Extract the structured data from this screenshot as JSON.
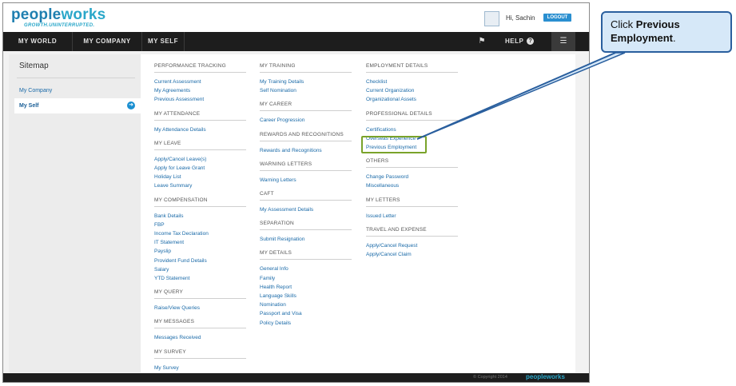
{
  "app": {
    "logo_text_a": "pe",
    "logo_text_b": "ple",
    "logo_text_c": "works",
    "tagline": "GROWTH.UNINTERRUPTED.",
    "greeting": "Hi, Sachin",
    "logout_label": "LOGOUT"
  },
  "nav": {
    "items": [
      {
        "label": "MY WORLD"
      },
      {
        "label": "MY COMPANY"
      },
      {
        "label": "MY SELF"
      }
    ],
    "help_label": "HELP"
  },
  "sidebar": {
    "title": "Sitemap",
    "items": [
      {
        "label": "My Company"
      },
      {
        "label": "My Self"
      }
    ]
  },
  "columns": {
    "col1": {
      "sections": [
        {
          "title": "PERFORMANCE TRACKING",
          "links": [
            "Current Assessment",
            "My Agreements",
            "Previous Assessment"
          ]
        },
        {
          "title": "MY ATTENDANCE",
          "links": [
            "My Attendance Details"
          ]
        },
        {
          "title": "MY LEAVE",
          "links": [
            "Apply/Cancel Leave(s)",
            "Apply for Leave Grant",
            "Holiday List",
            "Leave Summary"
          ]
        },
        {
          "title": "MY COMPENSATION",
          "links": [
            "Bank Details",
            "FBP",
            "Income Tax Declaration",
            "IT Statement",
            "Payslip",
            "Provident Fund Details",
            "Salary",
            "YTD Statement"
          ]
        },
        {
          "title": "MY QUERY",
          "links": [
            "Raise/View Queries"
          ]
        },
        {
          "title": "MY MESSAGES",
          "links": [
            "Messages Received"
          ]
        },
        {
          "title": "MY SURVEY",
          "links": [
            "My Survey"
          ]
        }
      ]
    },
    "col2": {
      "sections": [
        {
          "title": "MY TRAINING",
          "links": [
            "My Training Details",
            "Self Nomination"
          ]
        },
        {
          "title": "MY CAREER",
          "links": [
            "Career Progression"
          ]
        },
        {
          "title": "REWARDS AND RECOGNITIONS",
          "links": [
            "Rewards and Recognitions"
          ]
        },
        {
          "title": "WARNING LETTERS",
          "links": [
            "Warning Letters"
          ]
        },
        {
          "title": "CAFT",
          "links": [
            "My Assessment Details"
          ]
        },
        {
          "title": "SEPARATION",
          "links": [
            "Submit Resignation"
          ]
        },
        {
          "title": "MY DETAILS",
          "links": [
            "General Info",
            "Family",
            "Health Report",
            "Language Skills",
            "Nomination",
            "Passport and Visa",
            "Policy Details"
          ]
        }
      ]
    },
    "col3": {
      "sections": [
        {
          "title": "EMPLOYMENT DETAILS",
          "links": [
            "Checklist",
            "Current Organization",
            "Organizational Assets"
          ]
        },
        {
          "title": "PROFESSIONAL DETAILS",
          "links": [
            "Certifications",
            "Overseas Experience",
            "Previous Employment"
          ]
        },
        {
          "title": "OTHERS",
          "links": [
            "Change Password",
            "Miscellaneous"
          ]
        },
        {
          "title": "MY LETTERS",
          "links": [
            "Issued Letter"
          ]
        },
        {
          "title": "TRAVEL AND EXPENSE",
          "links": [
            "Apply/Cancel Request",
            "Apply/Cancel Claim"
          ]
        }
      ]
    }
  },
  "footer": {
    "copyright": "© Copyright 2014",
    "logo": "peopleworks"
  },
  "callout": {
    "prefix": "Click ",
    "target": "Previous Employment",
    "suffix": "."
  },
  "colors": {
    "accent": "#2aa7c9",
    "nav_bg": "#1d1d1d",
    "link": "#1a6aa8",
    "highlight": "#7aa32a",
    "callout_bg": "#d6e8f8",
    "callout_border": "#2a5f9e"
  },
  "icons": {
    "flag": "flag-icon",
    "help": "help-icon",
    "menu": "menu-icon",
    "arrow": "arrow-right-icon"
  }
}
